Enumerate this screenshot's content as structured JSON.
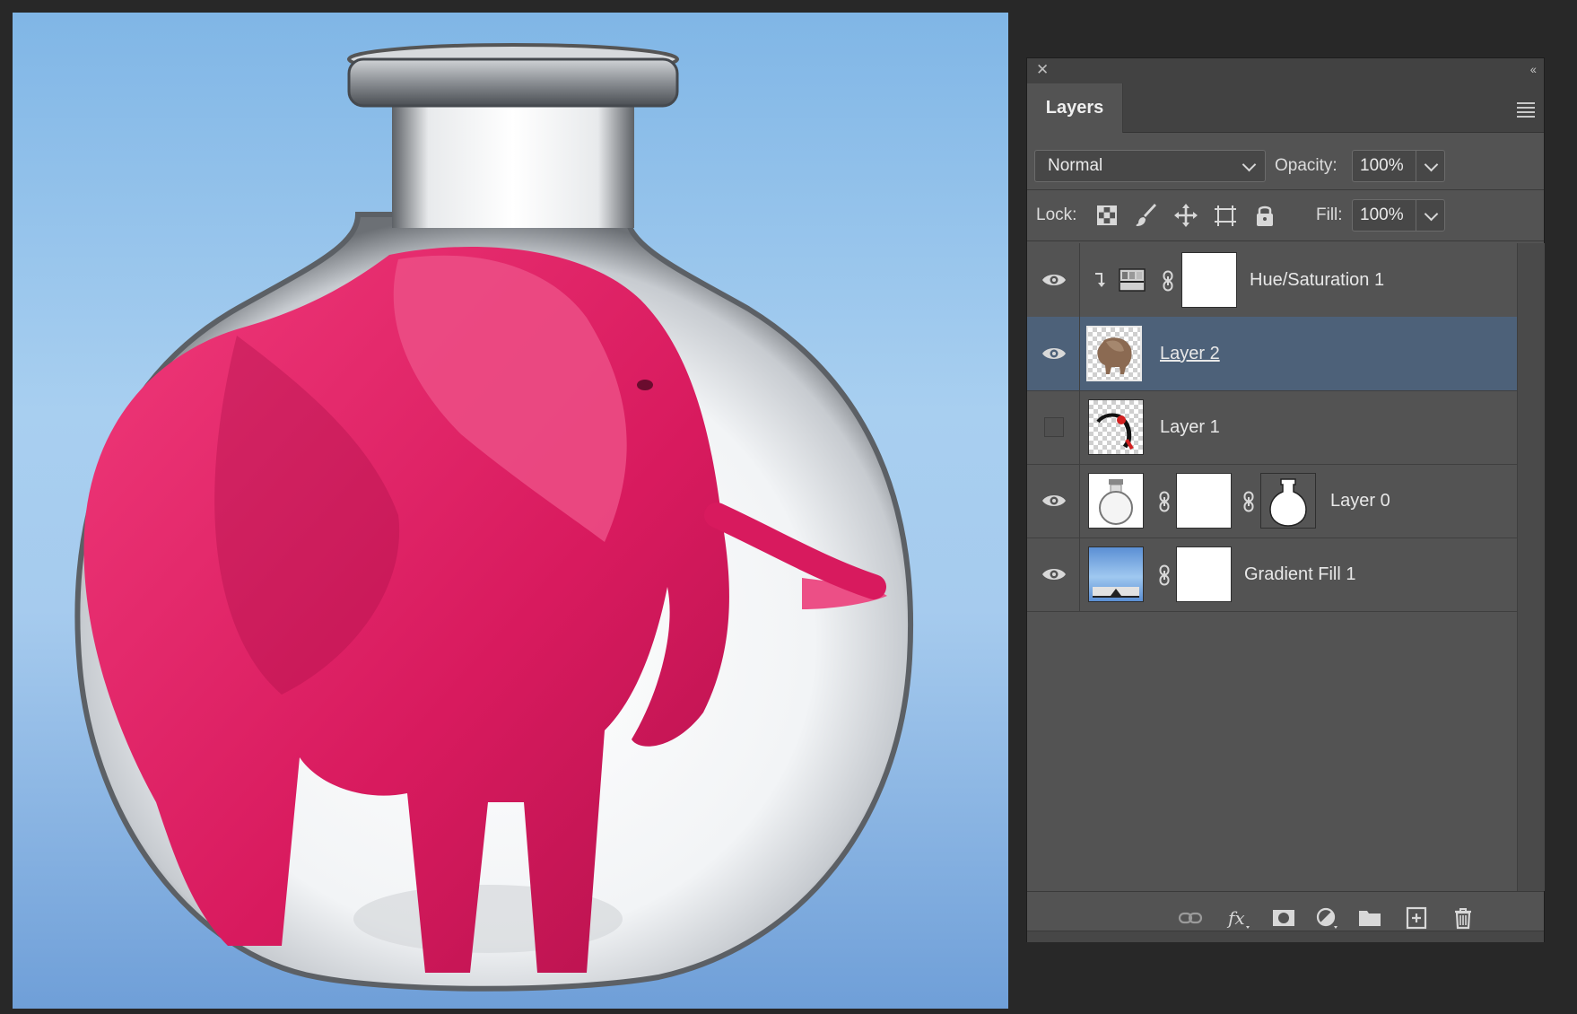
{
  "panel": {
    "tab_label": "Layers",
    "blend_mode": "Normal",
    "opacity_label": "Opacity:",
    "opacity_value": "100%",
    "lock_label": "Lock:",
    "fill_label": "Fill:",
    "fill_value": "100%"
  },
  "layers": [
    {
      "name": "Hue/Saturation 1",
      "visible": true,
      "selected": false,
      "kind": "adjustment-clipped"
    },
    {
      "name": "Layer 2",
      "visible": true,
      "selected": true,
      "kind": "pixel"
    },
    {
      "name": "Layer 1",
      "visible": false,
      "selected": false,
      "kind": "pixel"
    },
    {
      "name": "Layer 0",
      "visible": true,
      "selected": false,
      "kind": "pixel-with-masks"
    },
    {
      "name": "Gradient Fill 1",
      "visible": true,
      "selected": false,
      "kind": "fill-with-mask"
    }
  ],
  "icons": {
    "lock": [
      "lock-transparent-icon",
      "lock-paint-icon",
      "lock-position-icon",
      "lock-artboard-icon",
      "lock-all-icon"
    ],
    "footer": [
      "link-layers-icon",
      "fx-icon",
      "add-mask-icon",
      "adjustment-icon",
      "new-group-icon",
      "new-layer-icon",
      "delete-layer-icon"
    ]
  },
  "colors": {
    "panel_bg": "#535353",
    "selected_row": "#4d6179",
    "elephant": "#e01f63",
    "canvas_sky": "#80b6e6"
  }
}
